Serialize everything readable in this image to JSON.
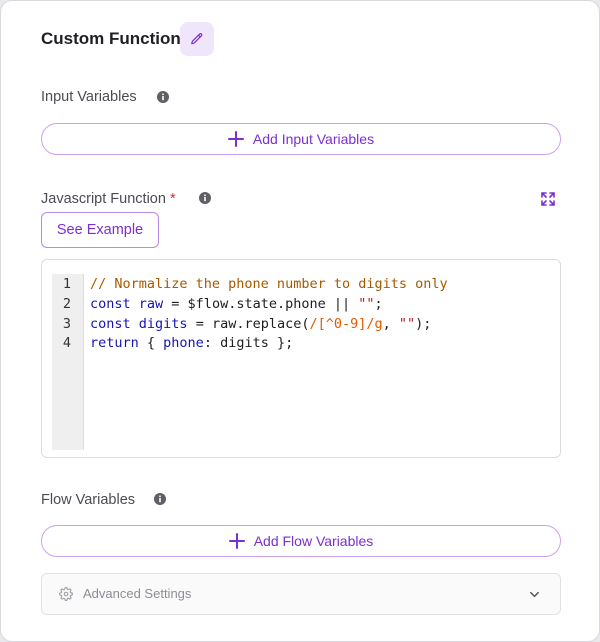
{
  "header": {
    "title": "Custom Function",
    "edit_icon": "pencil-icon"
  },
  "input_variables": {
    "label": "Input Variables",
    "info_icon": "info-icon",
    "add_button_label": "Add Input Variables",
    "add_icon": "plus-icon"
  },
  "javascript": {
    "label": "Javascript Function",
    "required_marker": "*",
    "info_icon": "info-icon",
    "expand_icon": "expand-icon",
    "see_example_label": "See Example",
    "line_numbers": [
      "1",
      "2",
      "3",
      "4"
    ],
    "code": [
      "// Normalize the phone number to digits only",
      "const raw = $flow.state.phone || \"\";",
      "const digits = raw.replace(/[^0-9]/g, \"\");",
      "return { phone: digits };"
    ]
  },
  "flow_variables": {
    "label": "Flow Variables",
    "info_icon": "info-icon",
    "add_button_label": "Add Flow Variables",
    "add_icon": "plus-icon"
  },
  "advanced": {
    "label": "Advanced Settings",
    "gear_icon": "gear-icon",
    "chevron_icon": "chevron-down-icon"
  },
  "colors": {
    "accent": "#7b2fd0",
    "accent_border": "#c9a2ee",
    "accent_bg": "#efe6fb",
    "required": "#e0282e"
  }
}
